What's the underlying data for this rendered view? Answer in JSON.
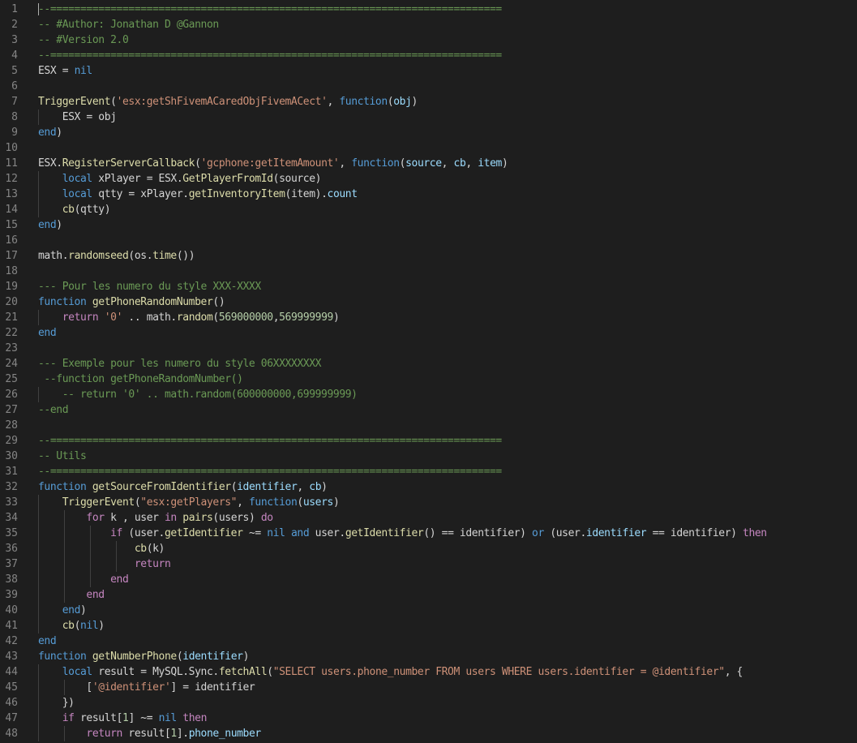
{
  "editor": {
    "language": "lua",
    "colors": {
      "background": "#1e1e1e",
      "line_number": "#858585",
      "default": "#d4d4d4",
      "comment": "#6a9955",
      "keyword": "#569cd6",
      "function": "#dcdcaa",
      "string": "#ce9178",
      "number": "#b5cea8",
      "variable": "#9cdcfe",
      "control": "#c586c0"
    },
    "lines": [
      {
        "n": "1",
        "indent": 0,
        "tokens": [
          [
            "c",
            "--==========================================================================="
          ]
        ]
      },
      {
        "n": "2",
        "indent": 0,
        "tokens": [
          [
            "c",
            "-- #Author: Jonathan D @Gannon"
          ]
        ]
      },
      {
        "n": "3",
        "indent": 0,
        "tokens": [
          [
            "c",
            "-- #Version 2.0"
          ]
        ]
      },
      {
        "n": "4",
        "indent": 0,
        "tokens": [
          [
            "c",
            "--==========================================================================="
          ]
        ]
      },
      {
        "n": "5",
        "indent": 0,
        "tokens": [
          [
            "t",
            "ESX = "
          ],
          [
            "k",
            "nil"
          ]
        ]
      },
      {
        "n": "6",
        "indent": 0,
        "tokens": []
      },
      {
        "n": "7",
        "indent": 0,
        "tokens": [
          [
            "f",
            "TriggerEvent"
          ],
          [
            "t",
            "("
          ],
          [
            "s",
            "'esx:getShFivemACaredObjFivemACect'"
          ],
          [
            "t",
            ", "
          ],
          [
            "k",
            "function"
          ],
          [
            "t",
            "("
          ],
          [
            "v",
            "obj"
          ],
          [
            "t",
            ")"
          ]
        ]
      },
      {
        "n": "8",
        "indent": 1,
        "tokens": [
          [
            "t",
            "    ESX = obj"
          ]
        ]
      },
      {
        "n": "9",
        "indent": 0,
        "tokens": [
          [
            "k",
            "end"
          ],
          [
            "t",
            ")"
          ]
        ]
      },
      {
        "n": "10",
        "indent": 0,
        "tokens": []
      },
      {
        "n": "11",
        "indent": 0,
        "tokens": [
          [
            "t",
            "ESX."
          ],
          [
            "f",
            "RegisterServerCallback"
          ],
          [
            "t",
            "("
          ],
          [
            "s",
            "'gcphone:getItemAmount'"
          ],
          [
            "t",
            ", "
          ],
          [
            "k",
            "function"
          ],
          [
            "t",
            "("
          ],
          [
            "v",
            "source"
          ],
          [
            "t",
            ", "
          ],
          [
            "v",
            "cb"
          ],
          [
            "t",
            ", "
          ],
          [
            "v",
            "item"
          ],
          [
            "t",
            ")"
          ]
        ]
      },
      {
        "n": "12",
        "indent": 1,
        "tokens": [
          [
            "t",
            "    "
          ],
          [
            "k",
            "local"
          ],
          [
            "t",
            " xPlayer = ESX."
          ],
          [
            "f",
            "GetPlayerFromId"
          ],
          [
            "t",
            "(source)"
          ]
        ]
      },
      {
        "n": "13",
        "indent": 1,
        "tokens": [
          [
            "t",
            "    "
          ],
          [
            "k",
            "local"
          ],
          [
            "t",
            " qtty = xPlayer."
          ],
          [
            "f",
            "getInventoryItem"
          ],
          [
            "t",
            "(item)."
          ],
          [
            "v",
            "count"
          ]
        ]
      },
      {
        "n": "14",
        "indent": 1,
        "tokens": [
          [
            "t",
            "    "
          ],
          [
            "f",
            "cb"
          ],
          [
            "t",
            "(qtty)"
          ]
        ]
      },
      {
        "n": "15",
        "indent": 0,
        "tokens": [
          [
            "k",
            "end"
          ],
          [
            "t",
            ")"
          ]
        ]
      },
      {
        "n": "16",
        "indent": 0,
        "tokens": []
      },
      {
        "n": "17",
        "indent": 0,
        "tokens": [
          [
            "t",
            "math."
          ],
          [
            "f",
            "randomseed"
          ],
          [
            "t",
            "(os."
          ],
          [
            "f",
            "time"
          ],
          [
            "t",
            "())"
          ]
        ]
      },
      {
        "n": "18",
        "indent": 0,
        "tokens": []
      },
      {
        "n": "19",
        "indent": 0,
        "tokens": [
          [
            "c",
            "--- Pour les numero du style XXX-XXXX"
          ]
        ]
      },
      {
        "n": "20",
        "indent": 0,
        "tokens": [
          [
            "k",
            "function"
          ],
          [
            "t",
            " "
          ],
          [
            "f",
            "getPhoneRandomNumber"
          ],
          [
            "t",
            "()"
          ]
        ]
      },
      {
        "n": "21",
        "indent": 1,
        "tokens": [
          [
            "t",
            "    "
          ],
          [
            "m",
            "return"
          ],
          [
            "t",
            " "
          ],
          [
            "s",
            "'0'"
          ],
          [
            "t",
            " .. math."
          ],
          [
            "f",
            "random"
          ],
          [
            "t",
            "("
          ],
          [
            "n",
            "569000000"
          ],
          [
            "t",
            ","
          ],
          [
            "n",
            "569999999"
          ],
          [
            "t",
            ")"
          ]
        ]
      },
      {
        "n": "22",
        "indent": 0,
        "tokens": [
          [
            "k",
            "end"
          ]
        ]
      },
      {
        "n": "23",
        "indent": 0,
        "tokens": []
      },
      {
        "n": "24",
        "indent": 0,
        "tokens": [
          [
            "c",
            "--- Exemple pour les numero du style 06XXXXXXXX"
          ]
        ]
      },
      {
        "n": "25",
        "indent": 0,
        "tokens": [
          [
            "c",
            " --function getPhoneRandomNumber()"
          ]
        ]
      },
      {
        "n": "26",
        "indent": 1,
        "tokens": [
          [
            "c",
            "    -- return '0' .. math.random(600000000,699999999)"
          ]
        ]
      },
      {
        "n": "27",
        "indent": 0,
        "tokens": [
          [
            "c",
            "--end"
          ]
        ]
      },
      {
        "n": "28",
        "indent": 0,
        "tokens": []
      },
      {
        "n": "29",
        "indent": 0,
        "tokens": [
          [
            "c",
            "--==========================================================================="
          ]
        ]
      },
      {
        "n": "30",
        "indent": 0,
        "tokens": [
          [
            "c",
            "-- Utils"
          ]
        ]
      },
      {
        "n": "31",
        "indent": 0,
        "tokens": [
          [
            "c",
            "--==========================================================================="
          ]
        ]
      },
      {
        "n": "32",
        "indent": 0,
        "tokens": [
          [
            "k",
            "function"
          ],
          [
            "t",
            " "
          ],
          [
            "f",
            "getSourceFromIdentifier"
          ],
          [
            "t",
            "("
          ],
          [
            "v",
            "identifier"
          ],
          [
            "t",
            ", "
          ],
          [
            "v",
            "cb"
          ],
          [
            "t",
            ")"
          ]
        ]
      },
      {
        "n": "33",
        "indent": 1,
        "tokens": [
          [
            "t",
            "    "
          ],
          [
            "f",
            "TriggerEvent"
          ],
          [
            "t",
            "("
          ],
          [
            "s",
            "\"esx:getPlayers\""
          ],
          [
            "t",
            ", "
          ],
          [
            "k",
            "function"
          ],
          [
            "t",
            "("
          ],
          [
            "v",
            "users"
          ],
          [
            "t",
            ")"
          ]
        ]
      },
      {
        "n": "34",
        "indent": 2,
        "tokens": [
          [
            "t",
            "        "
          ],
          [
            "m",
            "for"
          ],
          [
            "t",
            " k , user "
          ],
          [
            "m",
            "in"
          ],
          [
            "t",
            " "
          ],
          [
            "f",
            "pairs"
          ],
          [
            "t",
            "(users) "
          ],
          [
            "m",
            "do"
          ]
        ]
      },
      {
        "n": "35",
        "indent": 3,
        "tokens": [
          [
            "t",
            "            "
          ],
          [
            "m",
            "if"
          ],
          [
            "t",
            " (user."
          ],
          [
            "f",
            "getIdentifier"
          ],
          [
            "t",
            " ~= "
          ],
          [
            "k",
            "nil"
          ],
          [
            "t",
            " "
          ],
          [
            "k",
            "and"
          ],
          [
            "t",
            " user."
          ],
          [
            "f",
            "getIdentifier"
          ],
          [
            "t",
            "() == identifier) "
          ],
          [
            "k",
            "or"
          ],
          [
            "t",
            " (user."
          ],
          [
            "v",
            "identifier"
          ],
          [
            "t",
            " == identifier) "
          ],
          [
            "m",
            "then"
          ]
        ]
      },
      {
        "n": "36",
        "indent": 4,
        "tokens": [
          [
            "t",
            "                "
          ],
          [
            "f",
            "cb"
          ],
          [
            "t",
            "(k)"
          ]
        ]
      },
      {
        "n": "37",
        "indent": 4,
        "tokens": [
          [
            "t",
            "                "
          ],
          [
            "m",
            "return"
          ]
        ]
      },
      {
        "n": "38",
        "indent": 3,
        "tokens": [
          [
            "t",
            "            "
          ],
          [
            "m",
            "end"
          ]
        ]
      },
      {
        "n": "39",
        "indent": 2,
        "tokens": [
          [
            "t",
            "        "
          ],
          [
            "m",
            "end"
          ]
        ]
      },
      {
        "n": "40",
        "indent": 1,
        "tokens": [
          [
            "t",
            "    "
          ],
          [
            "k",
            "end"
          ],
          [
            "t",
            ")"
          ]
        ]
      },
      {
        "n": "41",
        "indent": 1,
        "tokens": [
          [
            "t",
            "    "
          ],
          [
            "f",
            "cb"
          ],
          [
            "t",
            "("
          ],
          [
            "k",
            "nil"
          ],
          [
            "t",
            ")"
          ]
        ]
      },
      {
        "n": "42",
        "indent": 0,
        "tokens": [
          [
            "k",
            "end"
          ]
        ]
      },
      {
        "n": "43",
        "indent": 0,
        "tokens": [
          [
            "k",
            "function"
          ],
          [
            "t",
            " "
          ],
          [
            "f",
            "getNumberPhone"
          ],
          [
            "t",
            "("
          ],
          [
            "v",
            "identifier"
          ],
          [
            "t",
            ")"
          ]
        ]
      },
      {
        "n": "44",
        "indent": 1,
        "tokens": [
          [
            "t",
            "    "
          ],
          [
            "k",
            "local"
          ],
          [
            "t",
            " result = MySQL.Sync."
          ],
          [
            "f",
            "fetchAll"
          ],
          [
            "t",
            "("
          ],
          [
            "s",
            "\"SELECT users.phone_number FROM users WHERE users.identifier = @identifier\""
          ],
          [
            "t",
            ", {"
          ]
        ]
      },
      {
        "n": "45",
        "indent": 2,
        "tokens": [
          [
            "t",
            "        ["
          ],
          [
            "s",
            "'@identifier'"
          ],
          [
            "t",
            "] = identifier"
          ]
        ]
      },
      {
        "n": "46",
        "indent": 1,
        "tokens": [
          [
            "t",
            "    })"
          ]
        ]
      },
      {
        "n": "47",
        "indent": 1,
        "tokens": [
          [
            "t",
            "    "
          ],
          [
            "m",
            "if"
          ],
          [
            "t",
            " result["
          ],
          [
            "n",
            "1"
          ],
          [
            "t",
            "] ~= "
          ],
          [
            "k",
            "nil"
          ],
          [
            "t",
            " "
          ],
          [
            "m",
            "then"
          ]
        ]
      },
      {
        "n": "48",
        "indent": 2,
        "tokens": [
          [
            "t",
            "        "
          ],
          [
            "m",
            "return"
          ],
          [
            "t",
            " result["
          ],
          [
            "n",
            "1"
          ],
          [
            "t",
            "]."
          ],
          [
            "v",
            "phone_number"
          ]
        ]
      }
    ]
  }
}
